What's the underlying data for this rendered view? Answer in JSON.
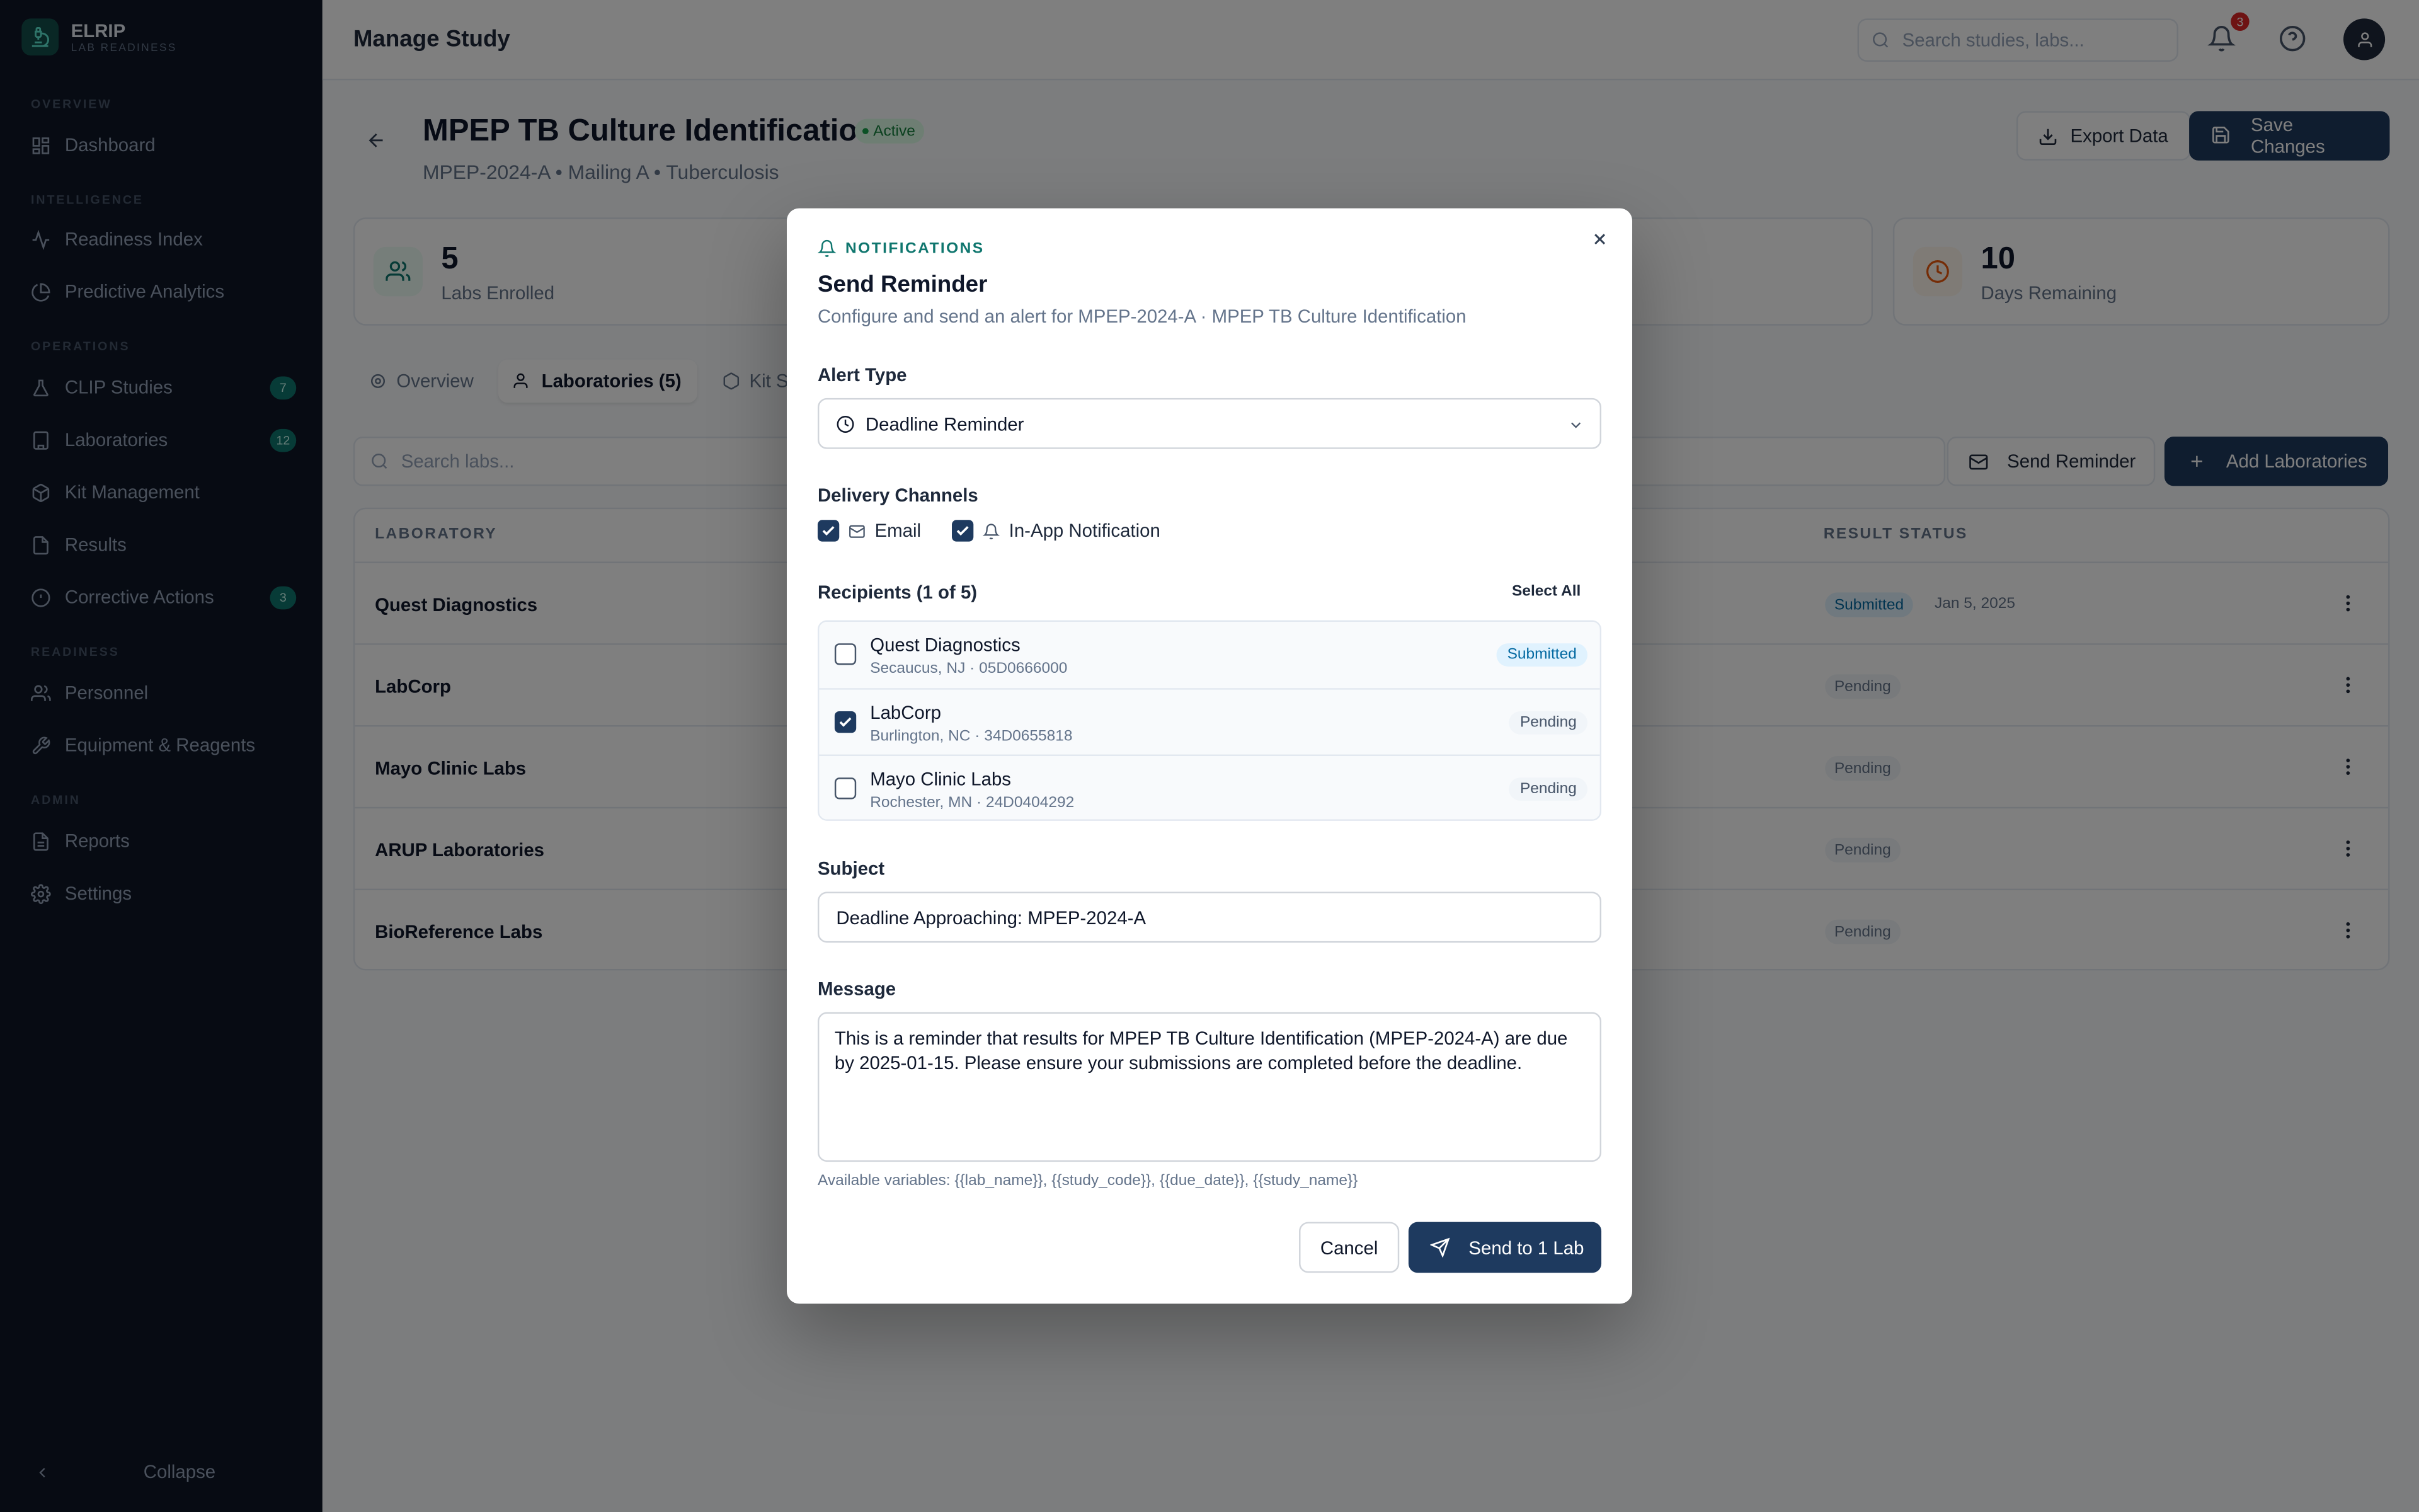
{
  "app": {
    "name": "ELRIP",
    "subtitle": "LAB READINESS"
  },
  "sidebar": {
    "sections": [
      {
        "label": "OVERVIEW"
      },
      {
        "label": "INTELLIGENCE"
      },
      {
        "label": "OPERATIONS"
      },
      {
        "label": "READINESS"
      },
      {
        "label": "ADMIN"
      }
    ],
    "items": [
      {
        "label": "Dashboard",
        "icon": "grid-icon"
      },
      {
        "label": "Readiness Index",
        "icon": "activity-icon"
      },
      {
        "label": "Predictive Analytics",
        "icon": "pie-chart-icon"
      },
      {
        "label": "CLIP Studies",
        "icon": "flask-icon",
        "badge": "7"
      },
      {
        "label": "Laboratories",
        "icon": "building-icon",
        "badge": "12"
      },
      {
        "label": "Kit Management",
        "icon": "package-icon"
      },
      {
        "label": "Results",
        "icon": "file-icon"
      },
      {
        "label": "Corrective Actions",
        "icon": "alert-circle-icon",
        "badge": "3"
      },
      {
        "label": "Personnel",
        "icon": "users-icon"
      },
      {
        "label": "Equipment & Reagents",
        "icon": "wrench-icon"
      },
      {
        "label": "Reports",
        "icon": "file-text-icon"
      },
      {
        "label": "Settings",
        "icon": "gear-icon"
      }
    ],
    "collapse_label": "Collapse"
  },
  "topbar": {
    "title": "Manage Study",
    "search_placeholder": "Search studies, labs...",
    "notification_count": "3"
  },
  "study": {
    "title": "MPEP TB Culture Identification",
    "status": "Active",
    "subtitle": "MPEP-2024-A • Mailing A • Tuberculosis",
    "export_label": "Export Data",
    "save_label": "Save Changes"
  },
  "stats": [
    {
      "value": "5",
      "label": "Labs Enrolled"
    },
    {
      "value": "10",
      "label": "Days Remaining"
    }
  ],
  "tabs": [
    {
      "label": "Overview"
    },
    {
      "label": "Laboratories (5)"
    },
    {
      "label": "Kit Sh"
    }
  ],
  "labs_toolbar": {
    "search_placeholder": "Search labs...",
    "send_reminder_label": "Send Reminder",
    "add_labs_label": "Add Laboratories"
  },
  "table": {
    "headers": [
      "LABORATORY",
      "RESULT STATUS"
    ],
    "rows": [
      {
        "lab": "Quest Diagnostics",
        "status": "Submitted",
        "date": "Jan 5, 2025"
      },
      {
        "lab": "LabCorp",
        "status": "Pending",
        "date": ""
      },
      {
        "lab": "Mayo Clinic Labs",
        "status": "Pending",
        "date": ""
      },
      {
        "lab": "ARUP Laboratories",
        "status": "Pending",
        "date": ""
      },
      {
        "lab": "BioReference Labs",
        "status": "Pending",
        "date": ""
      }
    ]
  },
  "modal": {
    "eyebrow": "NOTIFICATIONS",
    "title": "Send Reminder",
    "description": "Configure and send an alert for MPEP-2024-A · MPEP TB Culture Identification",
    "alert_type_label": "Alert Type",
    "alert_type_value": "Deadline Reminder",
    "delivery_label": "Delivery Channels",
    "channels": [
      {
        "label": "Email",
        "checked": true
      },
      {
        "label": "In-App Notification",
        "checked": true
      }
    ],
    "recipients_label": "Recipients (1 of 5)",
    "select_all_label": "Select All",
    "recipients": [
      {
        "name": "Quest Diagnostics",
        "address": "Secaucus, NJ · 05D0666000",
        "status": "Submitted",
        "checked": false
      },
      {
        "name": "LabCorp",
        "address": "Burlington, NC · 34D0655818",
        "status": "Pending",
        "checked": true
      },
      {
        "name": "Mayo Clinic Labs",
        "address": "Rochester, MN · 24D0404292",
        "status": "Pending",
        "checked": false
      }
    ],
    "subject_label": "Subject",
    "subject_value": "Deadline Approaching: MPEP-2024-A",
    "message_label": "Message",
    "message_value": "This is a reminder that results for MPEP TB Culture Identification (MPEP-2024-A) are due by 2025-01-15. Please ensure your submissions are completed before the deadline.",
    "variables_hint": "Available variables: {{lab_name}}, {{study_code}}, {{due_date}}, {{study_name}}",
    "cancel_label": "Cancel",
    "send_label": "Send to 1 Lab"
  },
  "colors": {
    "sidebar_bg": "#0e1626",
    "primary": "#1e3a5f",
    "accent_teal": "#0f766e",
    "active_green": "#15803d",
    "submitted_blue": "#0369a1",
    "danger": "#dc2626"
  }
}
